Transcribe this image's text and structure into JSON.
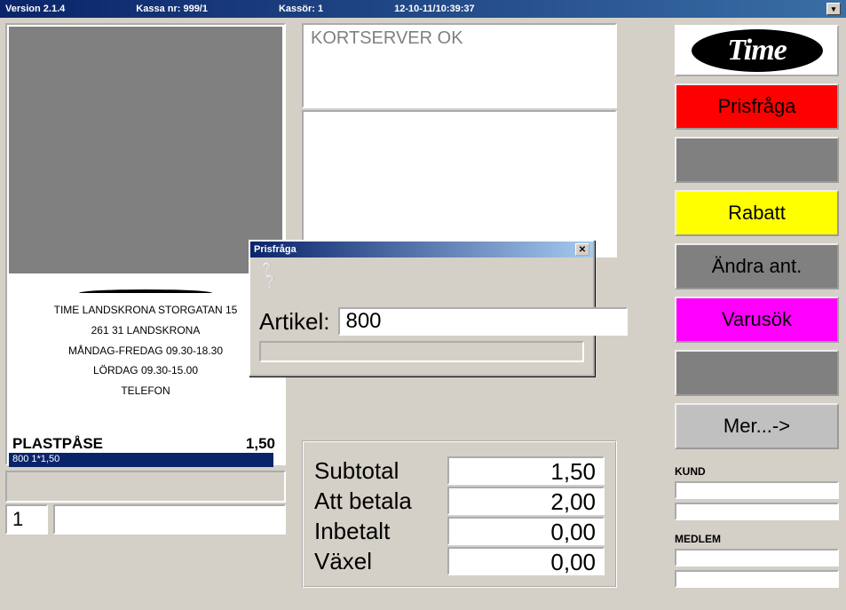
{
  "titlebar": {
    "version": "Version 2.1.4",
    "kassa": "Kassa nr: 999/1",
    "kassor": "Kassör: 1",
    "datetime": "12-10-11/10:39:37"
  },
  "receipt": {
    "header": [
      "TIME LANDSKRONA STORGATAN 15",
      "261 31 LANDSKRONA",
      "MÅNDAG-FREDAG 09.30-18.30",
      "LÖRDAG 09.30-15.00",
      "TELEFON"
    ],
    "line_item": {
      "name": "PLASTPÅSE",
      "price": "1,50"
    },
    "selected": "800  1*1,50",
    "qty": "1"
  },
  "status": {
    "text": "KORTSERVER OK"
  },
  "totals": {
    "rows": [
      {
        "label": "Subtotal",
        "value": "1,50"
      },
      {
        "label": "Att betala",
        "value": "2,00"
      },
      {
        "label": "Inbetalt",
        "value": "0,00"
      },
      {
        "label": "Växel",
        "value": "0,00"
      }
    ]
  },
  "logo_text": "Time",
  "side_buttons": [
    {
      "label": "Prisfråga",
      "color": "sb-red"
    },
    {
      "label": "",
      "color": "sb-gray"
    },
    {
      "label": "Rabatt",
      "color": "sb-yellow"
    },
    {
      "label": "Ändra ant.",
      "color": "sb-gray"
    },
    {
      "label": "Varusök",
      "color": "sb-mag"
    },
    {
      "label": "",
      "color": "sb-gray"
    },
    {
      "label": "Mer...->",
      "color": "sb-lgray"
    }
  ],
  "kund": {
    "kund_label": "KUND",
    "medlem_label": "MEDLEM"
  },
  "dialog": {
    "title": "Prisfråga",
    "field_label": "Artikel:",
    "field_value": "800"
  }
}
